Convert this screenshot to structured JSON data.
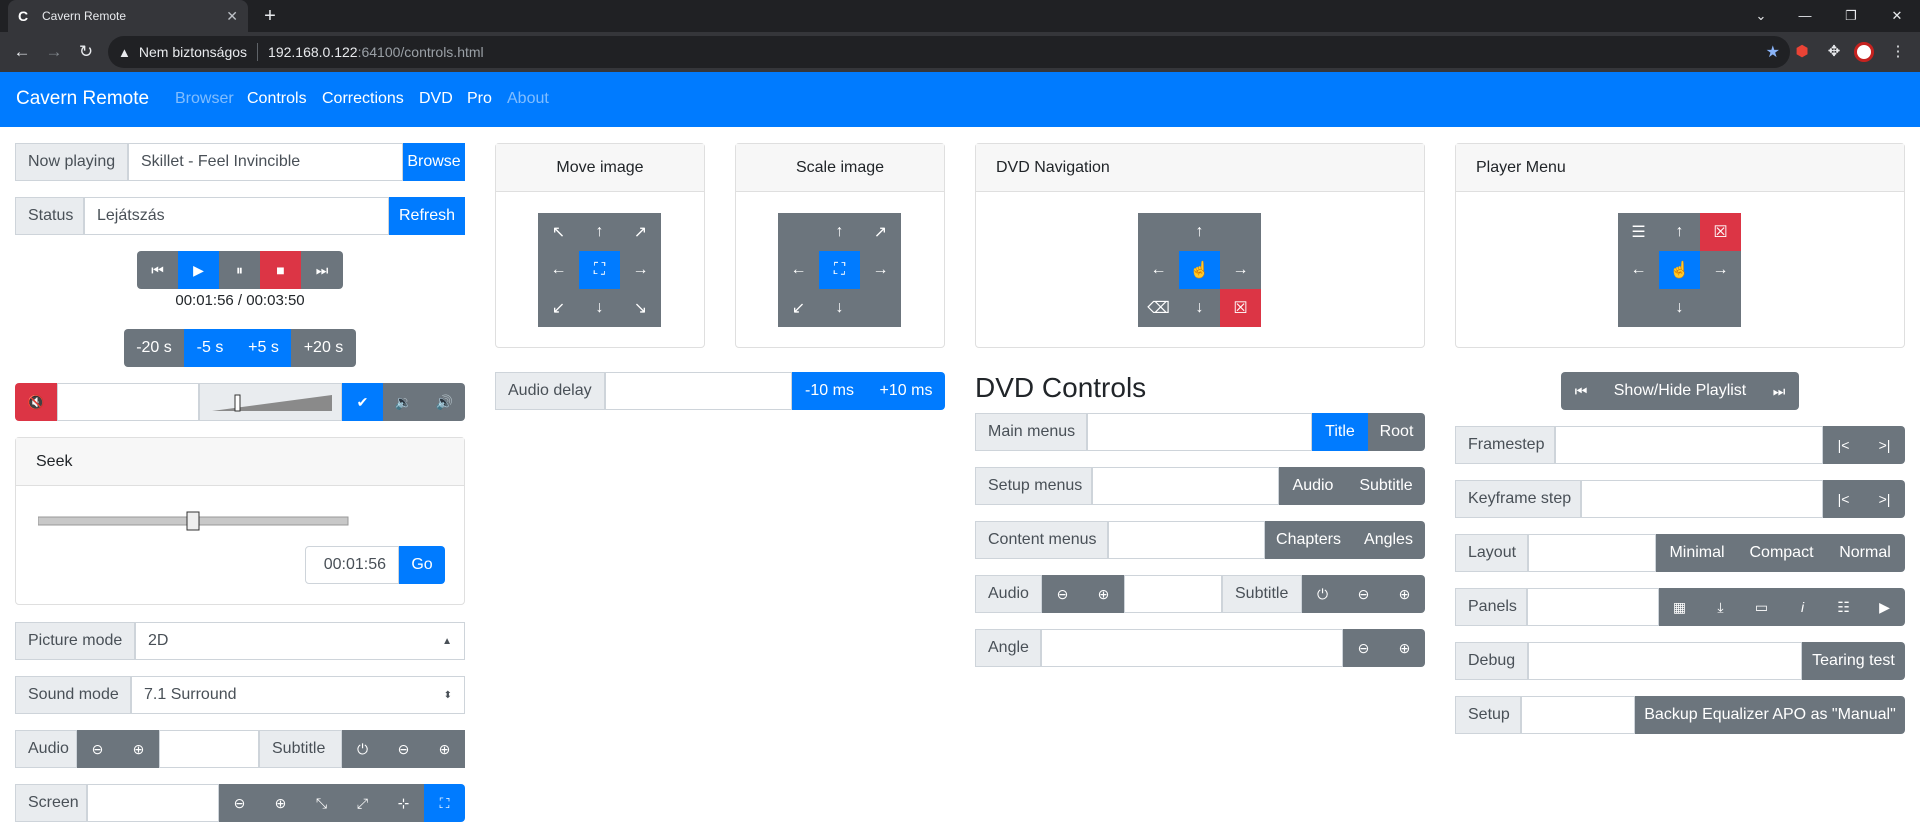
{
  "browser": {
    "tab_title": "Cavern Remote",
    "security": "Nem biztonságos",
    "url_host": "192.168.0.122",
    "url_path": ":64100/controls.html"
  },
  "navbar": {
    "brand": "Cavern Remote",
    "links": [
      "Browser",
      "Controls",
      "Corrections",
      "DVD",
      "Pro",
      "About"
    ]
  },
  "now_playing": {
    "label": "Now playing",
    "value": "Skillet - Feel Invincible",
    "button": "Browse"
  },
  "status": {
    "label": "Status",
    "value": "Lejátszás",
    "button": "Refresh"
  },
  "time": "00:01:56 / 00:03:50",
  "skip": [
    "-20 s",
    "-5 s",
    "+5 s",
    "+20 s"
  ],
  "volume_level": 0.2,
  "seek": {
    "title": "Seek",
    "position": 0.5,
    "time": "00:01:56",
    "go": "Go"
  },
  "picture_mode": {
    "label": "Picture mode",
    "value": "2D"
  },
  "sound_mode": {
    "label": "Sound mode",
    "value": "7.1 Surround"
  },
  "audio_subtitle": {
    "audio": "Audio",
    "subtitle": "Subtitle"
  },
  "screen": {
    "label": "Screen"
  },
  "move_image": {
    "title": "Move image"
  },
  "scale_image": {
    "title": "Scale image"
  },
  "audio_delay": {
    "label": "Audio delay",
    "minus": "-10 ms",
    "plus": "+10 ms"
  },
  "dvd_navigation": {
    "title": "DVD Navigation"
  },
  "dvd_controls": {
    "title": "DVD Controls",
    "main_menus": {
      "label": "Main menus",
      "title_btn": "Title",
      "root_btn": "Root"
    },
    "setup_menus": {
      "label": "Setup menus",
      "audio_btn": "Audio",
      "subtitle_btn": "Subtitle"
    },
    "content_menus": {
      "label": "Content menus",
      "chapters_btn": "Chapters",
      "angles_btn": "Angles"
    },
    "audio": "Audio",
    "subtitle": "Subtitle",
    "angle": "Angle"
  },
  "player_menu": {
    "title": "Player Menu"
  },
  "playlist": {
    "button": "Show/Hide Playlist"
  },
  "framestep": {
    "label": "Framestep"
  },
  "keyframe_step": {
    "label": "Keyframe step"
  },
  "layout": {
    "label": "Layout",
    "options": [
      "Minimal",
      "Compact",
      "Normal"
    ]
  },
  "panels": {
    "label": "Panels"
  },
  "debug": {
    "label": "Debug",
    "button": "Tearing test"
  },
  "setup": {
    "label": "Setup",
    "button": "Backup Equalizer APO as \"Manual\""
  }
}
